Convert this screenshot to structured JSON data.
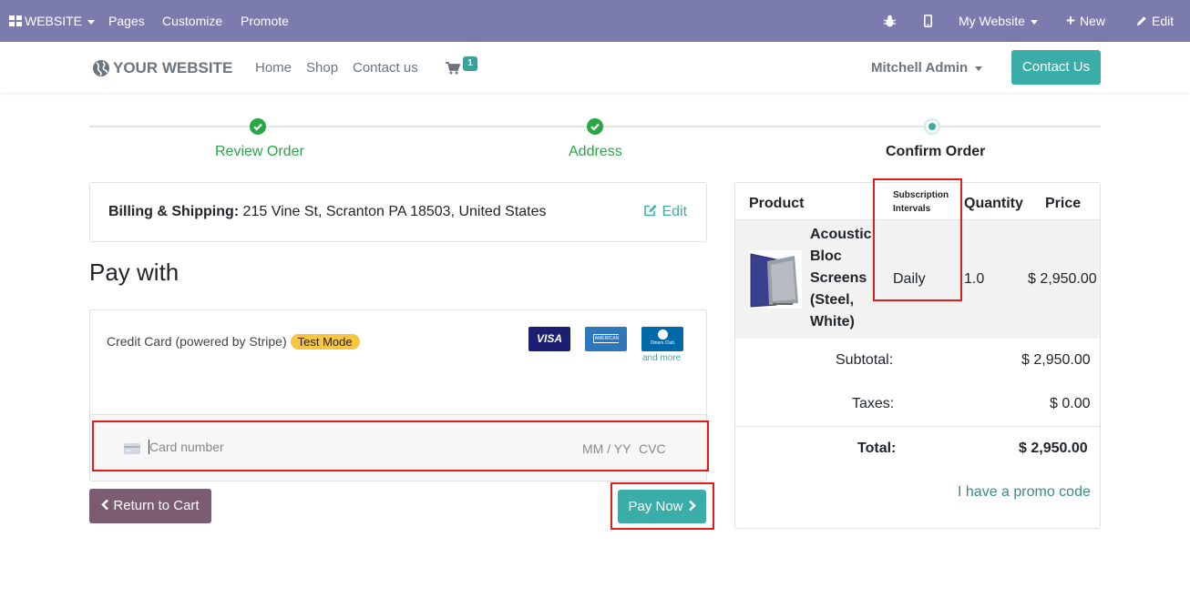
{
  "adminbar": {
    "website_label": "WEBSITE",
    "pages": "Pages",
    "customize": "Customize",
    "promote": "Promote",
    "my_website": "My Website",
    "new": "New",
    "edit": "Edit"
  },
  "header": {
    "logo_text": "YOUR WEBSITE",
    "nav": [
      "Home",
      "Shop",
      "Contact us"
    ],
    "cart_count": "1",
    "user": "Mitchell Admin",
    "contact_us": "Contact Us"
  },
  "steps": [
    {
      "label": "Review Order",
      "state": "done"
    },
    {
      "label": "Address",
      "state": "done"
    },
    {
      "label": "Confirm Order",
      "state": "current"
    }
  ],
  "billing": {
    "label": "Billing & Shipping:",
    "address": "215 Vine St, Scranton PA 18503, United States",
    "edit": "Edit"
  },
  "payment": {
    "heading": "Pay with",
    "method": "Credit Card (powered by Stripe)",
    "test_badge": "Test Mode",
    "cards": [
      "VISA",
      "AMERICAN EXPRESS",
      "Diners Club"
    ],
    "and_more": "and more",
    "card_placeholder": "Card number",
    "expiry_placeholder": "MM / YY",
    "cvc_placeholder": "CVC"
  },
  "buttons": {
    "return": "Return to Cart",
    "pay": "Pay Now"
  },
  "summary": {
    "headers": {
      "product": "Product",
      "interval": "Subscription Intervals",
      "quantity": "Quantity",
      "price": "Price"
    },
    "product": {
      "name_lines": [
        "Acoustic",
        "Bloc",
        "Screens",
        "(Steel,",
        "White)"
      ],
      "interval": "Daily",
      "quantity": "1.0",
      "price": "$ 2,950.00"
    },
    "subtotal_label": "Subtotal:",
    "subtotal": "$ 2,950.00",
    "taxes_label": "Taxes:",
    "taxes": "$ 0.00",
    "total_label": "Total:",
    "total": "$ 2,950.00",
    "promo": "I have a promo code"
  },
  "colors": {
    "adminbar": "#7c7bad",
    "teal": "#3aada8",
    "green": "#28a745",
    "return_button": "#7b5c72",
    "highlight": "#e41b1b"
  }
}
